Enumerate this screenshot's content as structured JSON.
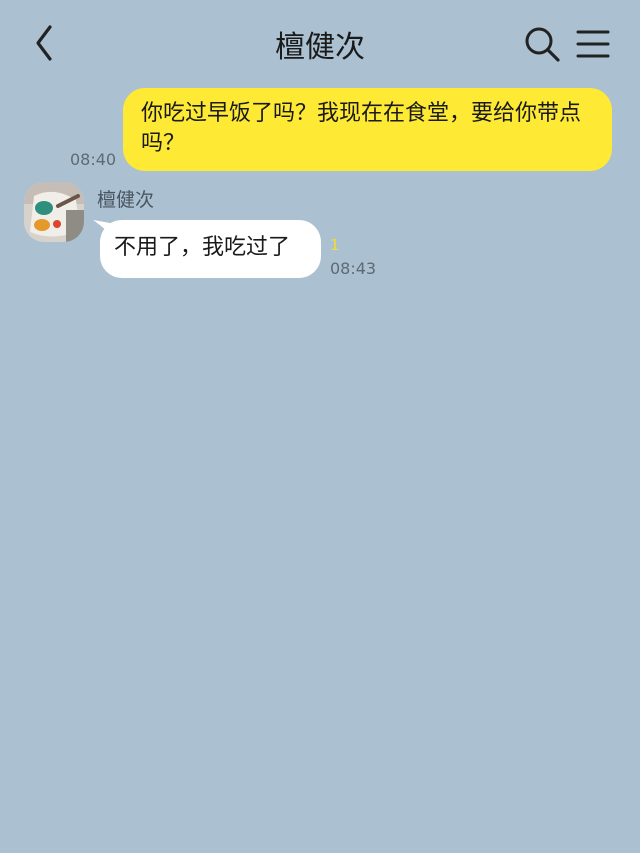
{
  "header": {
    "title": "檀健次",
    "icons": {
      "back": "back-chevron-icon",
      "search": "search-icon",
      "menu": "menu-icon"
    }
  },
  "messages": [
    {
      "direction": "outgoing",
      "text": "你吃过早饭了吗？我现在在食堂，要给你带点吗？",
      "time": "08:40",
      "bubble_color": "#fee934"
    },
    {
      "direction": "incoming",
      "sender": "檀健次",
      "text": "不用了，我吃过了",
      "unread": "1",
      "time": "08:43",
      "bubble_color": "#ffffff"
    }
  ],
  "colors": {
    "background": "#abc1d2",
    "accent": "#fee934"
  }
}
